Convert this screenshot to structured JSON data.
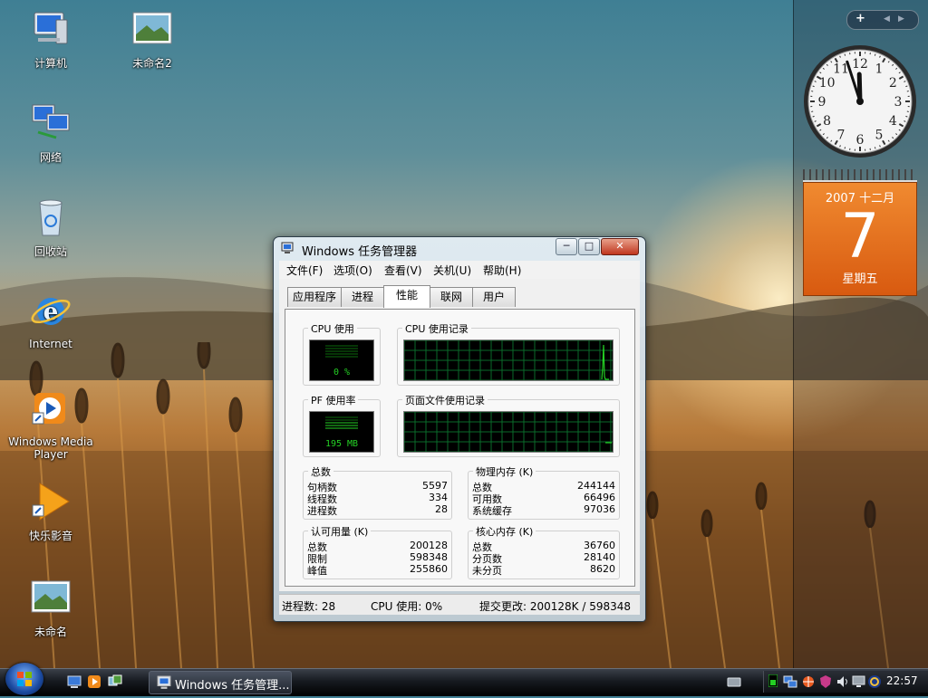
{
  "desktop": {
    "icons": [
      {
        "label": "计算机"
      },
      {
        "label": "未命名2"
      },
      {
        "label": "网络"
      },
      {
        "label": "回收站"
      },
      {
        "label": "Internet"
      },
      {
        "label": "Windows Media Player"
      },
      {
        "label": "快乐影音"
      },
      {
        "label": "未命名"
      }
    ]
  },
  "sidebar": {
    "controls": {
      "add": "+",
      "prev": "◀",
      "next": "▶"
    },
    "clock": {
      "hour": 11,
      "minute": 57,
      "numbers": [
        "12",
        "1",
        "2",
        "3",
        "4",
        "5",
        "6",
        "7",
        "8",
        "9",
        "10",
        "11"
      ]
    },
    "calendar": {
      "year_month": "2007 十二月",
      "day": "7",
      "weekday": "星期五"
    }
  },
  "window": {
    "title": "Windows 任务管理器",
    "buttons": {
      "minimize": "─",
      "maximize": "□",
      "close": "✕"
    },
    "menu": [
      "文件(F)",
      "选项(O)",
      "查看(V)",
      "关机(U)",
      "帮助(H)"
    ],
    "tabs": [
      "应用程序",
      "进程",
      "性能",
      "联网",
      "用户"
    ],
    "active_tab": "性能",
    "perf": {
      "cpu_usage": {
        "label": "CPU 使用",
        "value": "0 %"
      },
      "cpu_history": {
        "label": "CPU 使用记录"
      },
      "pf_usage": {
        "label": "PF 使用率",
        "value": "195 MB"
      },
      "pf_history": {
        "label": "页面文件使用记录"
      },
      "totals": {
        "label": "总数",
        "rows": [
          {
            "k": "句柄数",
            "v": "5597"
          },
          {
            "k": "线程数",
            "v": "334"
          },
          {
            "k": "进程数",
            "v": "28"
          }
        ]
      },
      "physical": {
        "label": "物理内存 (K)",
        "rows": [
          {
            "k": "总数",
            "v": "244144"
          },
          {
            "k": "可用数",
            "v": "66496"
          },
          {
            "k": "系统缓存",
            "v": "97036"
          }
        ]
      },
      "commit": {
        "label": "认可用量 (K)",
        "rows": [
          {
            "k": "总数",
            "v": "200128"
          },
          {
            "k": "限制",
            "v": "598348"
          },
          {
            "k": "峰值",
            "v": "255860"
          }
        ]
      },
      "kernel": {
        "label": "核心内存 (K)",
        "rows": [
          {
            "k": "总数",
            "v": "36760"
          },
          {
            "k": "分页数",
            "v": "28140"
          },
          {
            "k": "未分页",
            "v": "8620"
          }
        ]
      }
    },
    "status": {
      "processes": "进程数: 28",
      "cpu": "CPU 使用: 0%",
      "commit": "提交更改: 200128K / 598348"
    }
  },
  "taskbar": {
    "task_button": "Windows 任务管理...",
    "time": "22:57"
  }
}
